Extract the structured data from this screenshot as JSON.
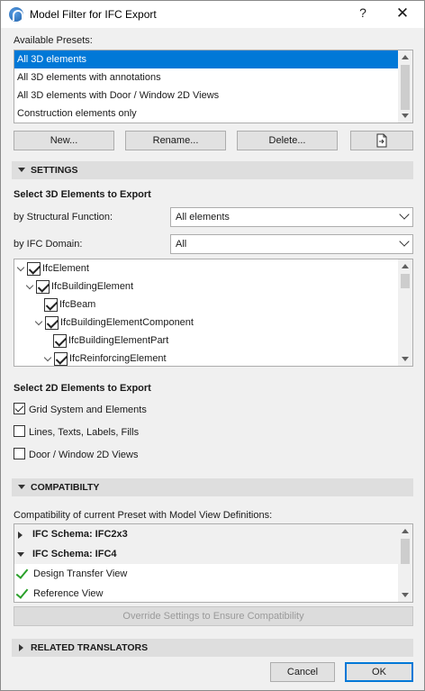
{
  "window": {
    "title": "Model Filter for IFC Export",
    "help": "?",
    "close": "✕"
  },
  "presets": {
    "label": "Available Presets:",
    "items": [
      "All 3D elements",
      "All 3D elements with annotations",
      "All 3D elements with Door / Window 2D Views",
      "Construction elements only"
    ],
    "selected": "All 3D elements",
    "buttons": {
      "new": "New...",
      "rename": "Rename...",
      "delete": "Delete..."
    }
  },
  "settings": {
    "header": "SETTINGS",
    "select3d": "Select 3D Elements to Export",
    "structural_label": "by Structural Function:",
    "structural_value": "All elements",
    "domain_label": "by IFC Domain:",
    "domain_value": "All",
    "tree": [
      {
        "label": "IfcElement",
        "checked": true
      },
      {
        "label": "IfcBuildingElement",
        "checked": true
      },
      {
        "label": "IfcBeam",
        "checked": true
      },
      {
        "label": "IfcBuildingElementComponent",
        "checked": true
      },
      {
        "label": "IfcBuildingElementPart",
        "checked": true
      },
      {
        "label": "IfcReinforcingElement",
        "checked": true
      }
    ],
    "select2d": "Select 2D Elements to Export",
    "options2d": [
      {
        "label": "Grid System and Elements",
        "checked": true
      },
      {
        "label": "Lines, Texts, Labels, Fills",
        "checked": false
      },
      {
        "label": "Door / Window 2D Views",
        "checked": false
      }
    ]
  },
  "compat": {
    "header": "COMPATIBILTY",
    "label": "Compatibility of current Preset with Model View Definitions:",
    "rows": [
      {
        "label": "IFC Schema: IFC2x3",
        "kind": "schema",
        "expanded": false
      },
      {
        "label": "IFC Schema: IFC4",
        "kind": "schema",
        "expanded": true
      },
      {
        "label": "Design Transfer View",
        "kind": "view",
        "status": "ok"
      },
      {
        "label": "Reference View",
        "kind": "view",
        "status": "ok"
      }
    ],
    "override_button": "Override Settings to Ensure Compatibility"
  },
  "translators": {
    "header": "RELATED TRANSLATORS"
  },
  "footer": {
    "cancel": "Cancel",
    "ok": "OK"
  },
  "colors": {
    "accent": "#0078d7",
    "ok": "#2aa02a"
  }
}
